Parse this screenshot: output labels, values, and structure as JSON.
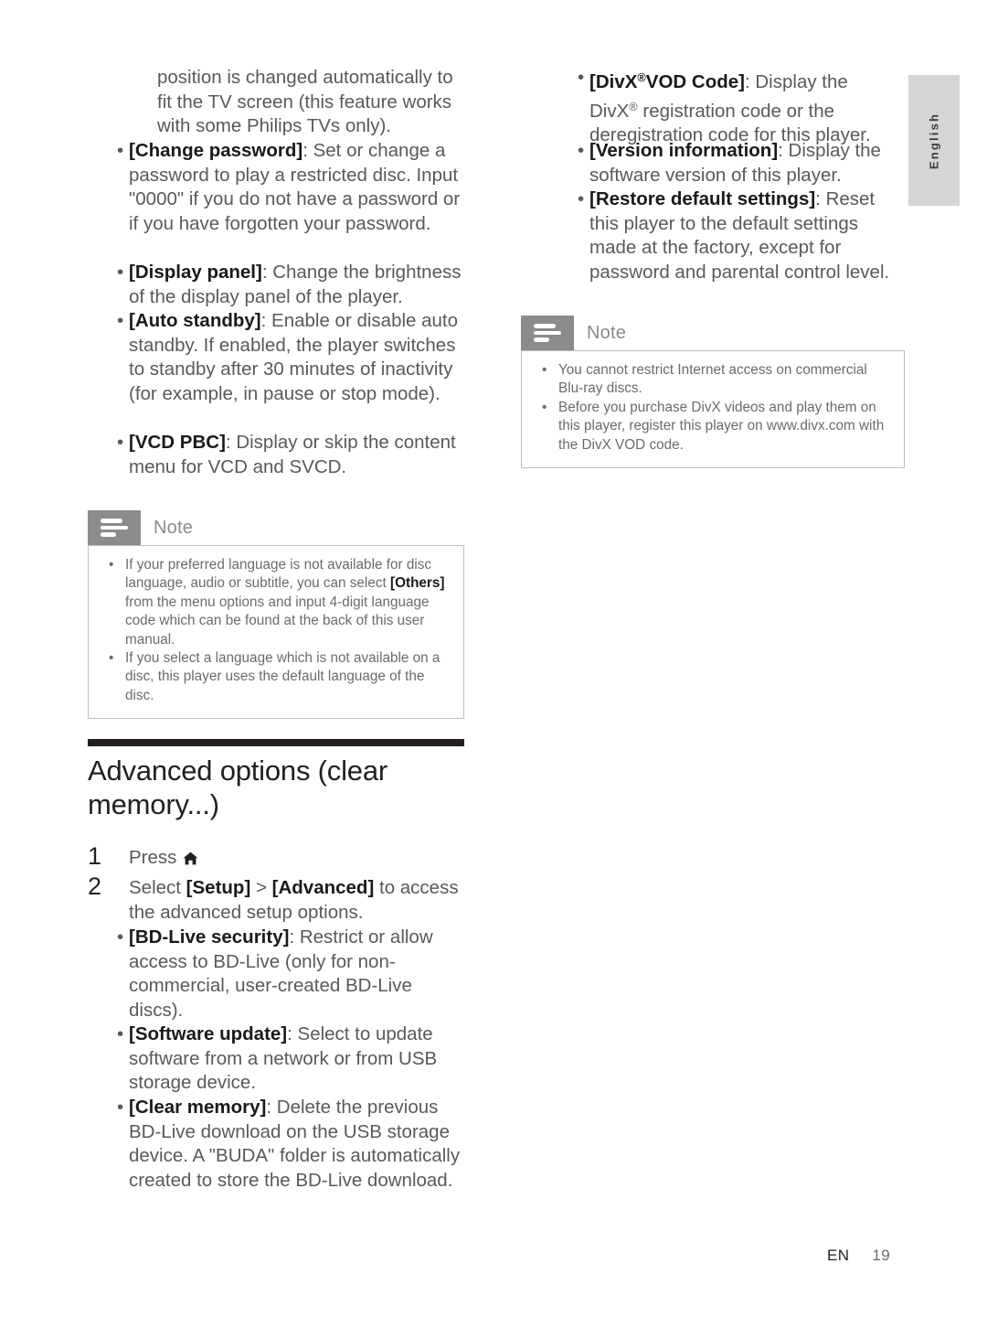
{
  "page": {
    "language_tab": "English",
    "footer": {
      "locale": "EN",
      "page_number": "19"
    }
  },
  "left_column": {
    "continued_paragraph": "position is changed automatically to fit the TV screen (this feature works with some Philips TVs only).",
    "bullets": [
      {
        "term": "[Change password]",
        "text": ": Set or change a password to play a restricted disc. Input \"0000\" if you do not have a password or if you have forgotten your password."
      },
      {
        "term": "[Display panel]",
        "text": ": Change the brightness of the display panel of the player."
      },
      {
        "term": "[Auto standby]",
        "text": ": Enable or disable auto standby. If enabled, the player switches to standby after 30 minutes of inactivity (for example, in pause or stop mode)."
      },
      {
        "term": "[VCD PBC]",
        "text": ": Display or skip the content menu for VCD and SVCD."
      }
    ],
    "note": {
      "icon": "note-lines-icon",
      "title": "Note",
      "items": [
        {
          "pre": "If your preferred language is not available for disc language, audio or subtitle, you can select ",
          "bold": "[Others]",
          "post": " from the menu options and input 4-digit language code which can be found at the back of this user manual."
        },
        {
          "pre": "If you select a language which is not available on a disc, this player uses the default language of the disc.",
          "bold": "",
          "post": ""
        }
      ]
    },
    "section": {
      "heading": "Advanced options (clear memory...)",
      "steps": [
        {
          "num": "1",
          "pre": "Press ",
          "icon": "home-icon",
          "post": "."
        },
        {
          "num": "2",
          "pre": "Select ",
          "icon": "",
          "post": ""
        }
      ],
      "step2": {
        "lead": "Select ",
        "bold1": "[Setup]",
        "mid": " > ",
        "bold2": "[Advanced]",
        "tail": " to access the advanced setup options."
      },
      "bullets": [
        {
          "term": "[BD-Live security]",
          "text": ": Restrict or allow access to BD-Live (only for non-commercial, user-created BD-Live discs)."
        },
        {
          "term": "[Software update]",
          "text": ": Select to update software from a network or from USB storage device."
        },
        {
          "term": "[Clear memory]",
          "text": ": Delete the previous BD-Live download on the USB storage device. A \"BUDA\" folder is automatically created to store the BD-Live download."
        }
      ]
    }
  },
  "right_column": {
    "bullets": [
      {
        "term_pre": "[DivX",
        "term_reg": "®",
        "term_post": "VOD Code]",
        "text_pre": ": Display the DivX",
        "text_reg": "®",
        "text_post": " registration code or the deregistration code for this player."
      }
    ],
    "bullet2": {
      "term": "[Version information]",
      "text": ": Display the software version of this player."
    },
    "bullet3": {
      "term": "[Restore default settings]",
      "text": ": Reset this player to the default settings made at the factory, except for password and parental control level."
    },
    "note": {
      "icon": "note-lines-icon",
      "title": "Note",
      "items": [
        "You cannot restrict Internet access on commercial Blu-ray discs.",
        "Before you purchase DivX videos and play them on this player, register this player on www.divx.com with the DivX VOD code."
      ]
    }
  },
  "colors": {
    "body_text": "#58595b",
    "bold_text": "#1a1a1a",
    "note_grey": "#8a8b8d",
    "note_border": "#bcbdbf",
    "tab_grey": "#d4d5d7",
    "rule_black": "#231f20"
  }
}
